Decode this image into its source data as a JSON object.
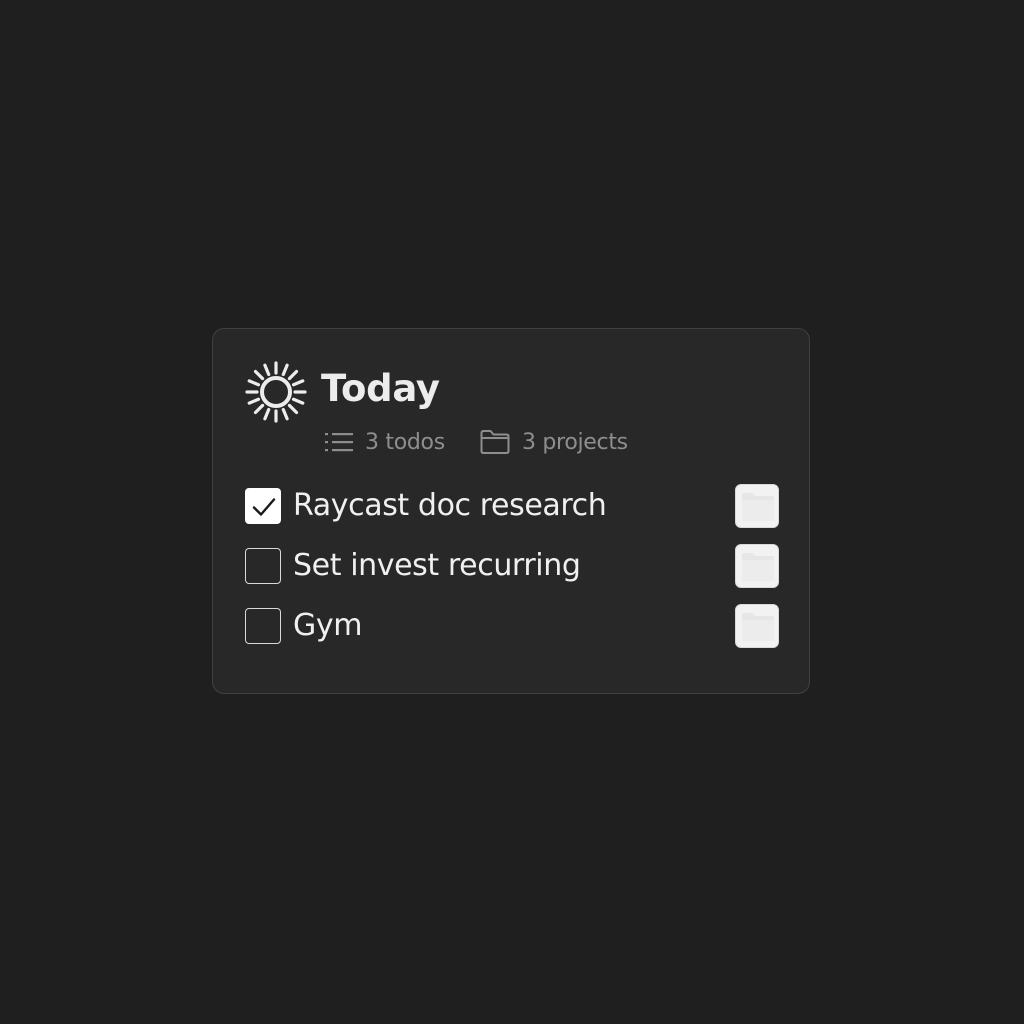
{
  "header": {
    "icon": "sun-icon",
    "title": "Today",
    "todos_icon": "list-icon",
    "todos_count": "3 todos",
    "projects_icon": "folder-icon",
    "projects_count": "3 projects"
  },
  "todos": [
    {
      "label": "Raycast doc research",
      "checked": true,
      "project_icon": "folder-icon"
    },
    {
      "label": "Set invest recurring",
      "checked": false,
      "project_icon": "folder-icon"
    },
    {
      "label": "Gym",
      "checked": false,
      "project_icon": "folder-icon"
    }
  ],
  "colors": {
    "background": "#1f1f1f",
    "card": "#282828",
    "text": "#f0f0f0",
    "muted": "#8e8e8e"
  }
}
